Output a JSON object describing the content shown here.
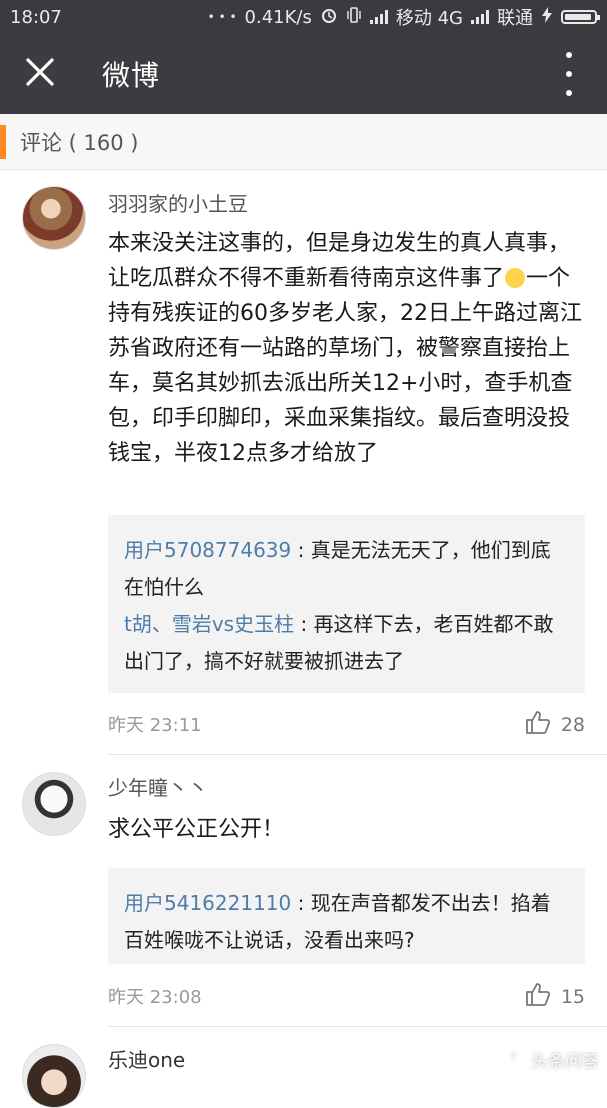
{
  "status": {
    "time": "18:07",
    "dots": "• • •",
    "speed": "0.41K/s",
    "carrier1": "移动 4G",
    "carrier2": "联通"
  },
  "app_bar": {
    "title": "微博"
  },
  "section": {
    "label": "评论 ( 160 )"
  },
  "comments": [
    {
      "user": "羽羽家的小土豆",
      "text_part1": "本来没关注这事的，但是身边发生的真人真事，让吃瓜群众不得不重新看待南京这件事了",
      "text_part2": "一个持有残疾证的60多岁老人家，22日上午路过离江苏省政府还有一站路的草场门，被警察直接抬上车，莫名其妙抓去派出所关12+小时，查手机查包，印手印脚印，采血采集指纹。最后查明没投钱宝，半夜12点多才给放了",
      "replies": [
        {
          "user": "用户5708774639",
          "sep": " : ",
          "text": "真是无法无天了，他们到底在怕什么"
        },
        {
          "user": "t胡、雪岩vs史玉柱",
          "sep": " : ",
          "text": "再这样下去，老百姓都不敢出门了，搞不好就要被抓进去了"
        }
      ],
      "time": "昨天 23:11",
      "likes": "28"
    },
    {
      "user": "少年瞳丶丶",
      "text": "求公平公正公开！",
      "replies": [
        {
          "user": "用户5416221110",
          "sep": " : ",
          "text": "现在声音都发不出去！掐着百姓喉咙不让说话，没看出来吗?"
        }
      ],
      "time": "昨天 23:08",
      "likes": "15"
    },
    {
      "user": "乐迪one"
    }
  ],
  "watermark": {
    "text": "头条问答"
  },
  "icons": {
    "close": "close-icon",
    "more": "more-vertical-icon",
    "like": "thumbs-up-icon",
    "alarm": "alarm-icon",
    "vibrate": "vibrate-icon",
    "charging": "charging-icon"
  },
  "colors": {
    "accent": "#ff8a1f",
    "link": "#4e7da9",
    "bar": "#3b3c40"
  }
}
